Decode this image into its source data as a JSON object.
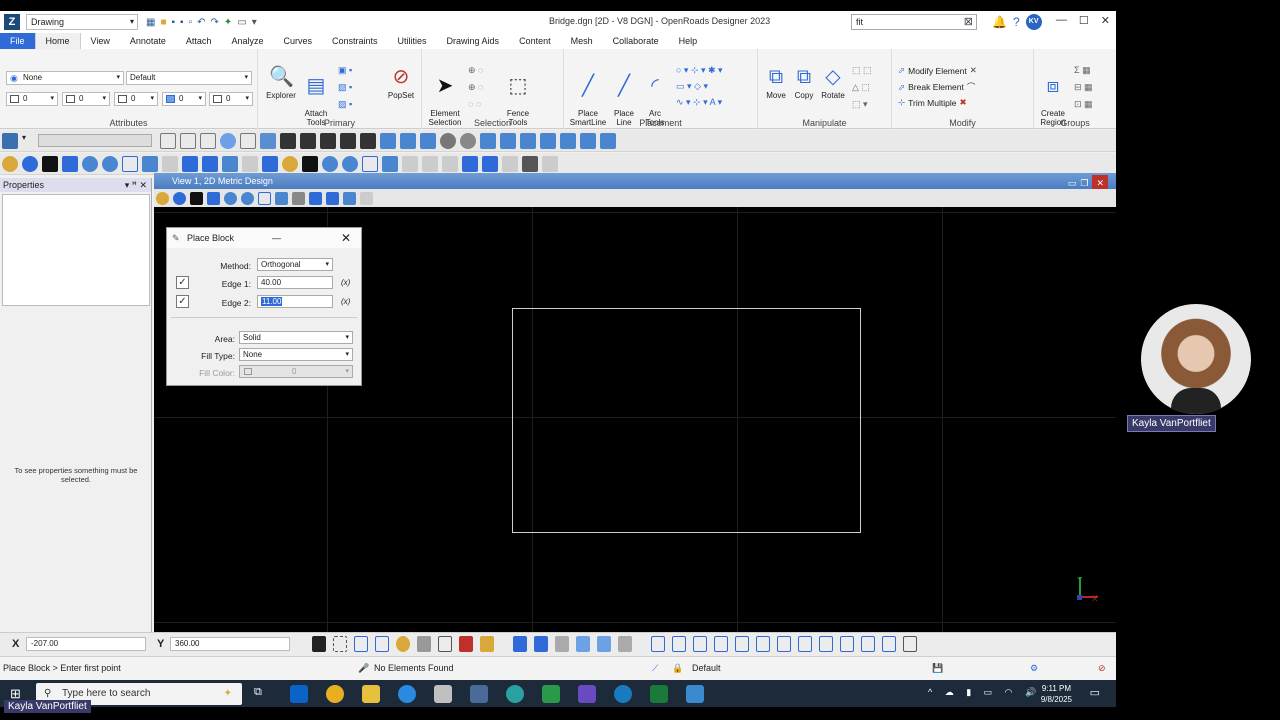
{
  "titlebar": {
    "workspace": "Drawing",
    "title": "Bridge.dgn [2D - V8 DGN] - OpenRoads Designer 2023",
    "search_value": "fit",
    "user_initials": "KV"
  },
  "tabs": [
    "File",
    "Home",
    "View",
    "Annotate",
    "Attach",
    "Analyze",
    "Curves",
    "Constraints",
    "Utilities",
    "Drawing Aids",
    "Content",
    "Mesh",
    "Collaborate",
    "Help"
  ],
  "ribbon": {
    "attributes": {
      "level": "None",
      "style": "Default",
      "color": "0",
      "weight": "0",
      "line_style": "0",
      "transparency": "0",
      "priority": "0",
      "label": "Attributes"
    },
    "primary": {
      "explorer": "Explorer",
      "attach_tools": "Attach\nTools",
      "popset": "PopSet",
      "label": "Primary"
    },
    "selection": {
      "element_selection": "Element\nSelection",
      "fence_tools": "Fence\nTools",
      "label": "Selection"
    },
    "placement": {
      "place_smartline": "Place\nSmartLine",
      "place_line": "Place\nLine",
      "arc_tools": "Arc\nTools",
      "label": "Placement"
    },
    "manipulate": {
      "move": "Move",
      "copy": "Copy",
      "rotate": "Rotate",
      "label": "Manipulate"
    },
    "modify": {
      "modify_element": "Modify Element",
      "break_element": "Break Element",
      "trim_multiple": "Trim Multiple",
      "label": "Modify"
    },
    "groups": {
      "create_region": "Create\nRegion",
      "label": "Groups"
    }
  },
  "properties_panel": {
    "title": "Properties",
    "message": "To see properties something must be selected."
  },
  "view": {
    "title": "View 1, 2D Metric Design"
  },
  "dialog": {
    "title": "Place Block",
    "method_label": "Method:",
    "method_value": "Orthogonal",
    "edge1_label": "Edge 1:",
    "edge1_value": "40.00",
    "edge1_checked": true,
    "edge2_label": "Edge 2:",
    "edge2_value": "11.00",
    "edge2_checked": true,
    "area_label": "Area:",
    "area_value": "Solid",
    "fill_type_label": "Fill Type:",
    "fill_type_value": "None",
    "fill_color_label": "Fill Color:",
    "fill_color_value": "0",
    "lock_glyph": "(x)"
  },
  "coords": {
    "x_label": "X",
    "x_value": "-207.00",
    "y_label": "Y",
    "y_value": "360.00"
  },
  "status": {
    "prompt": "Place Block > Enter first point",
    "selection": "No Elements Found",
    "level": "Default"
  },
  "taskbar": {
    "search_placeholder": "Type here to search",
    "time": "9:11 PM",
    "date": "9/8/2025"
  },
  "presenter": {
    "name": "Kayla VanPortfliet",
    "caption": "Kayla VanPortfliet"
  },
  "colors": {
    "accent": "#2f6bd8",
    "view_bg": "#000000",
    "view_title": "#4a7cc0"
  }
}
